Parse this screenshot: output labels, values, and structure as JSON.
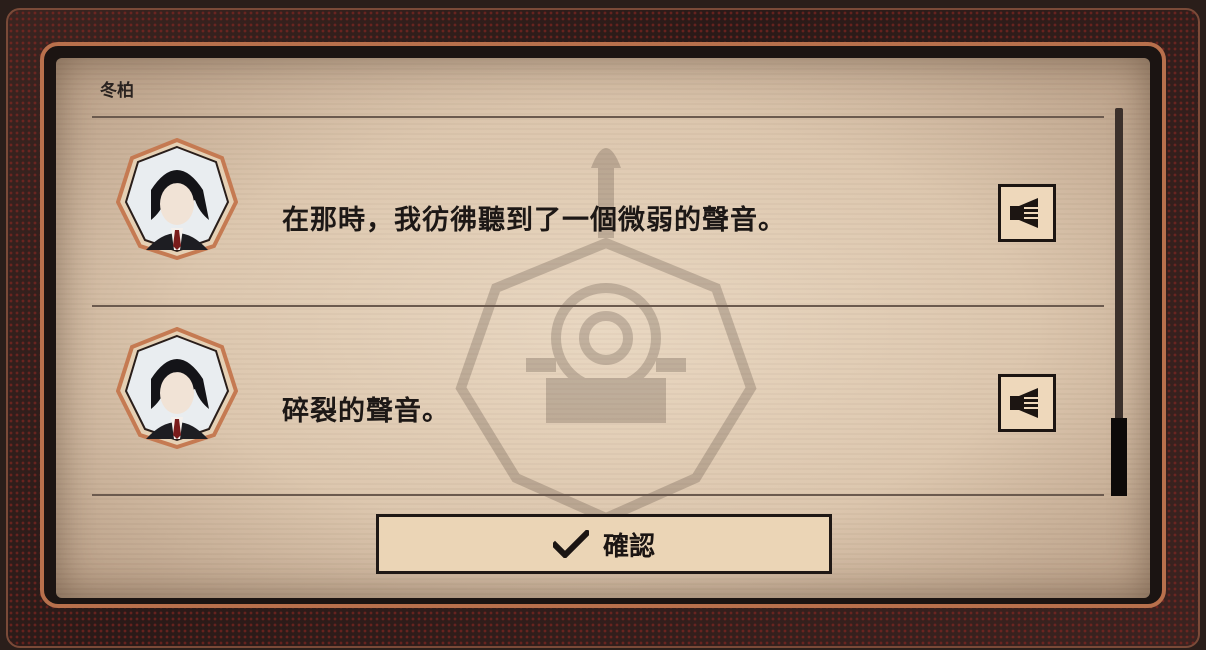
{
  "dialog": {
    "speaker_header": "冬柏",
    "entries": [
      {
        "speaker": "冬柏",
        "text": "在那時，我彷彿聽到了一個微弱的聲音。",
        "voice_icon": "speaker-icon"
      },
      {
        "speaker": "冬柏",
        "text": "碎裂的聲音。",
        "voice_icon": "speaker-icon"
      }
    ],
    "confirm_label": "確認",
    "confirm_icon": "checkmark-icon"
  },
  "colors": {
    "panel_bg": "#e4d0b8",
    "frame_accent": "#b8704c",
    "button_bg": "#ebd5b6",
    "text": "#1d1816"
  }
}
